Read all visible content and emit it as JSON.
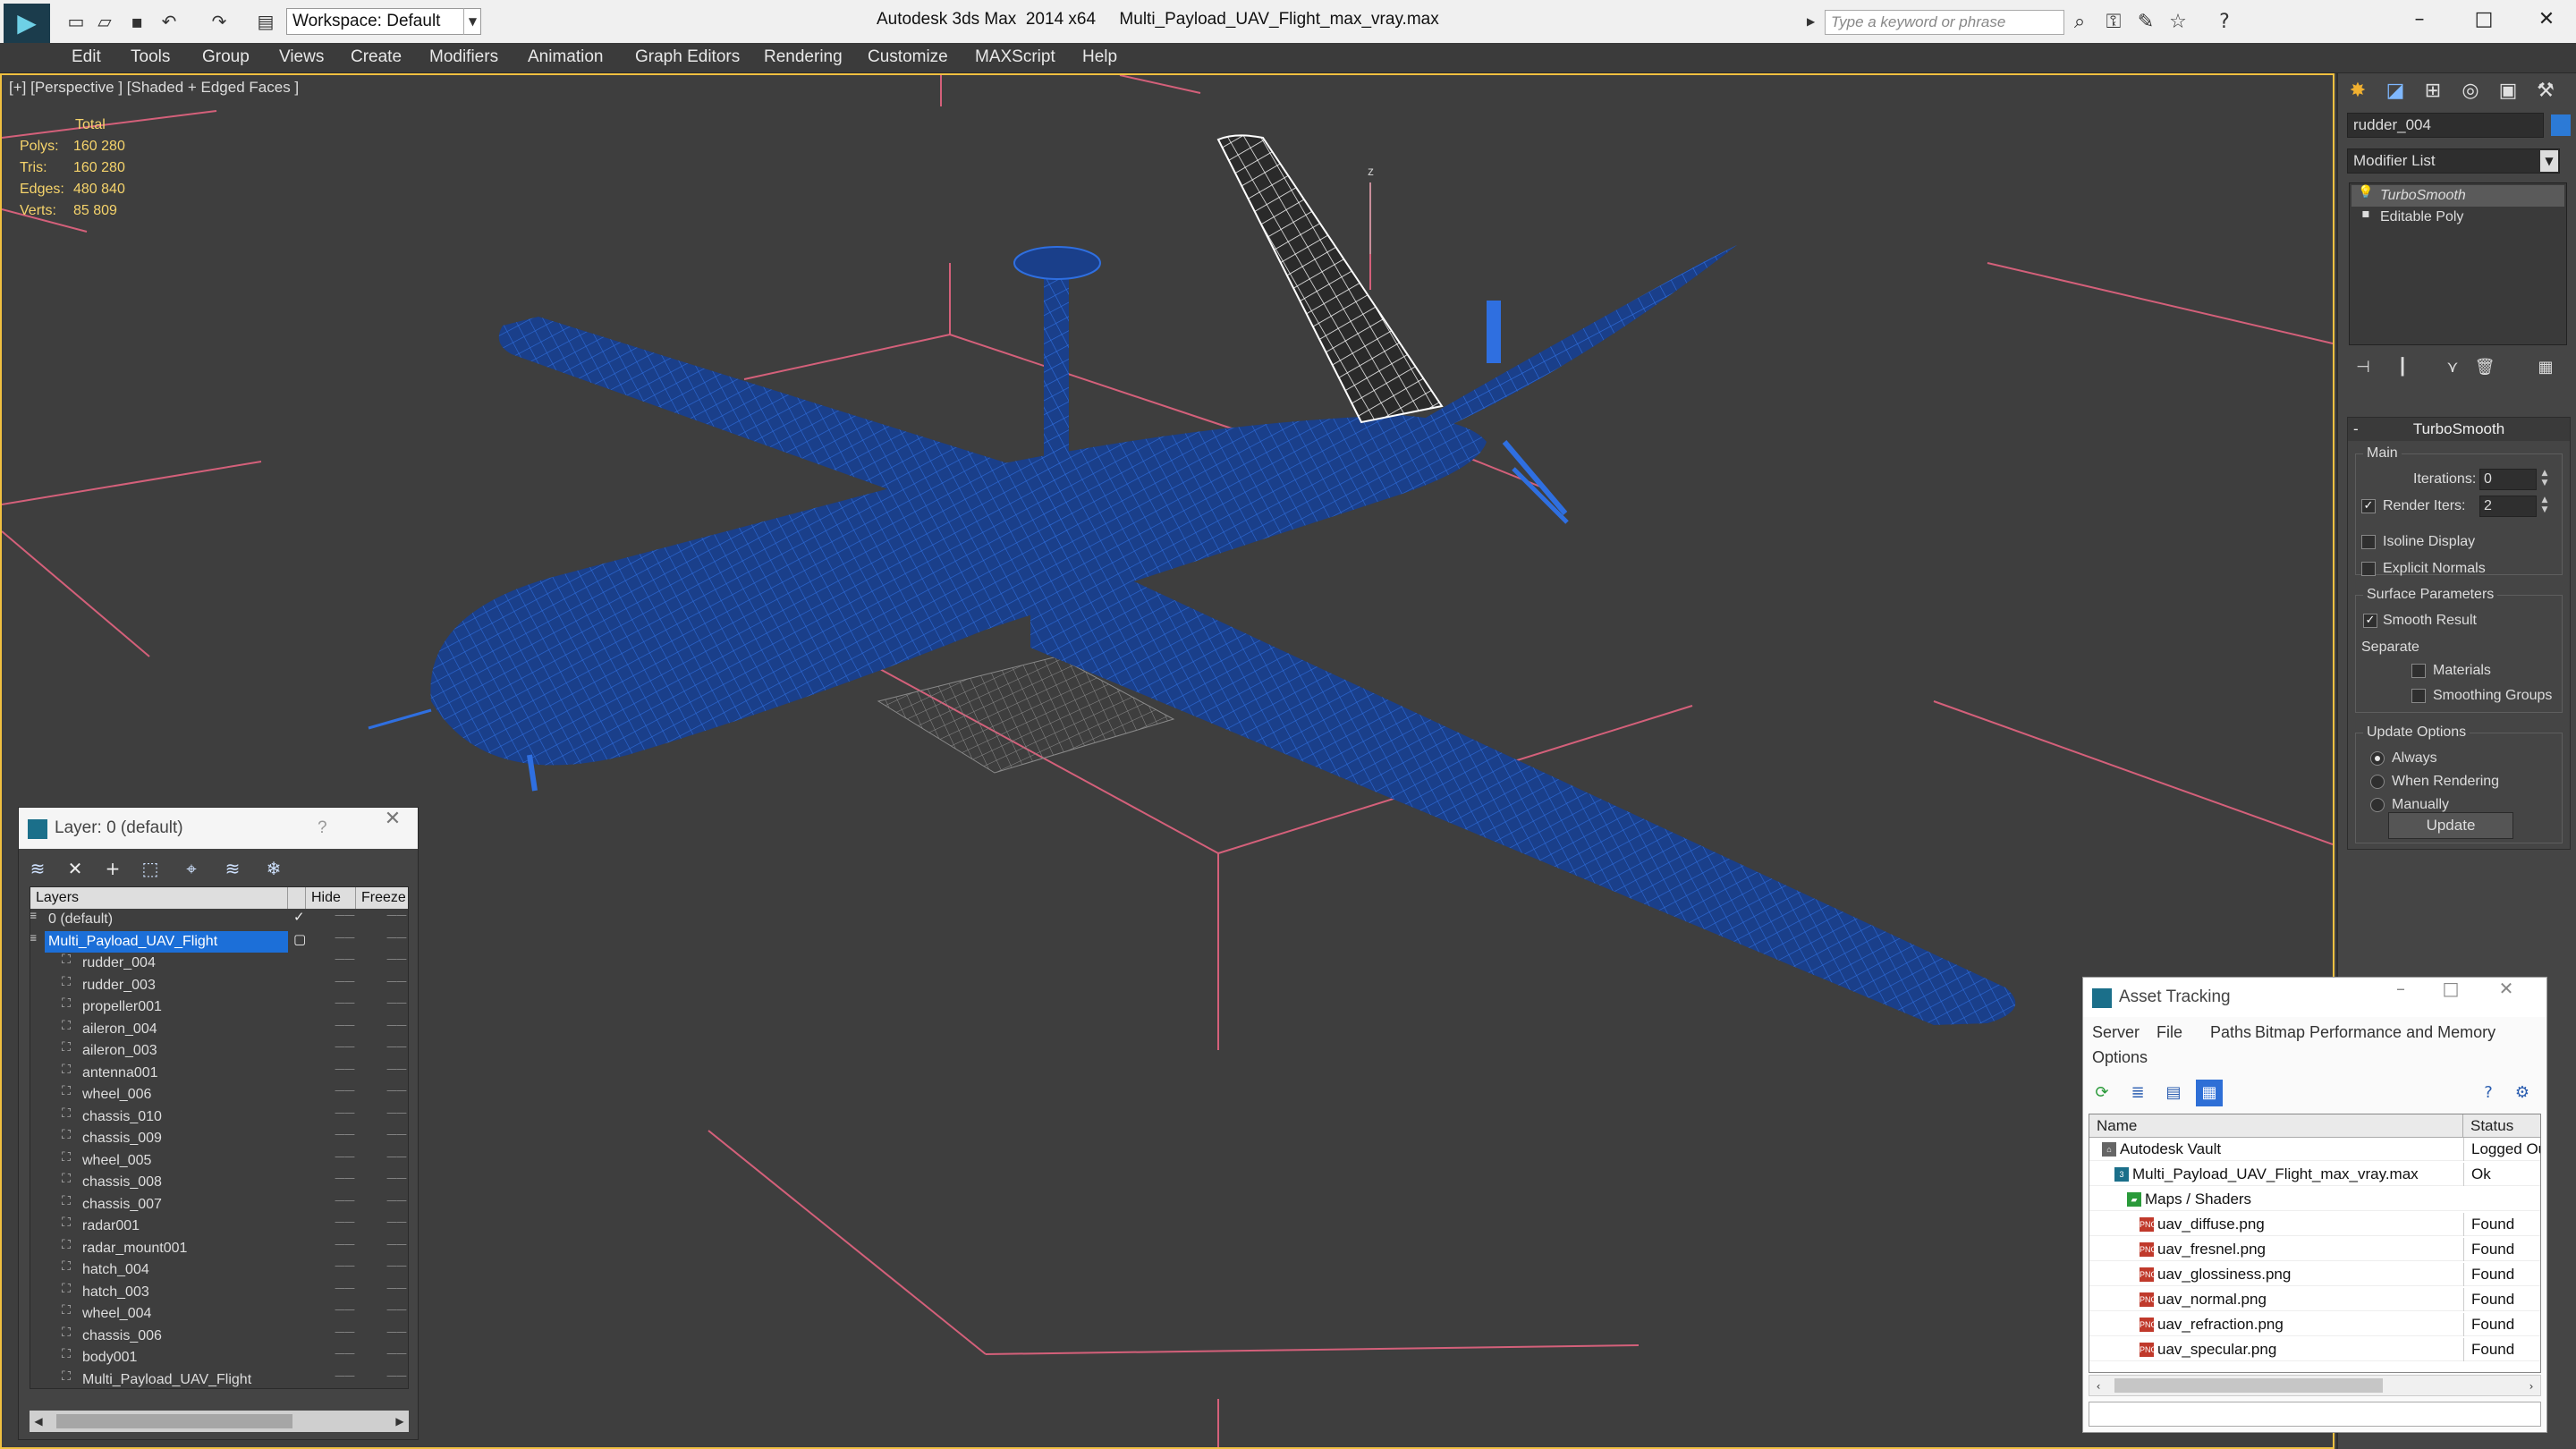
{
  "app": {
    "title": "Autodesk 3ds Max  2014 x64     Multi_Payload_UAV_Flight_max_vray.max",
    "logo": "3ds",
    "workspace": "Workspace: Default",
    "search_placeholder": "Type a keyword or phrase"
  },
  "menu": [
    "Edit",
    "Tools",
    "Group",
    "Views",
    "Create",
    "Modifiers",
    "Animation",
    "Graph Editors",
    "Rendering",
    "Customize",
    "MAXScript",
    "Help"
  ],
  "viewport": {
    "label": "[+] [Perspective ] [Shaded + Edged Faces ]",
    "stats": {
      "header": "Total",
      "rows": [
        {
          "key": "Polys:",
          "value": "160 280"
        },
        {
          "key": "Tris:",
          "value": "160 280"
        },
        {
          "key": "Edges:",
          "value": "480 840"
        },
        {
          "key": "Verts:",
          "value": "85 809"
        }
      ]
    },
    "axis_label": "z",
    "mesh_color": "#1a3f8a",
    "wire_color": "#2f6fe0",
    "grid_color": "#d4607a"
  },
  "command_panel": {
    "object_name": "rudder_004",
    "object_color": "#2c7ad6",
    "modifier_list": "Modifier List",
    "stack": [
      "TurboSmooth",
      "Editable Poly"
    ],
    "rollout_title": "TurboSmooth",
    "main": {
      "title": "Main",
      "iterations_label": "Iterations:",
      "iterations": "0",
      "render_iters_label": "Render Iters:",
      "render_iters": "2",
      "render_iters_checked": true,
      "isoline_label": "Isoline Display",
      "explicit_normals_label": "Explicit Normals"
    },
    "surface": {
      "title": "Surface Parameters",
      "smooth_result_label": "Smooth Result",
      "separate_label": "Separate",
      "materials_label": "Materials",
      "smoothing_groups_label": "Smoothing Groups"
    },
    "update": {
      "title": "Update Options",
      "always": "Always",
      "when_rendering": "When Rendering",
      "manually": "Manually",
      "button": "Update"
    }
  },
  "layer_panel": {
    "title": "Layer: 0 (default)",
    "help": "?",
    "columns": [
      "Layers",
      "Hide",
      "Freeze"
    ],
    "rows": [
      {
        "name": "0 (default)",
        "level": 0,
        "checked": true
      },
      {
        "name": "Multi_Payload_UAV_Flight",
        "level": 0,
        "selected": true
      },
      {
        "name": "rudder_004",
        "level": 1
      },
      {
        "name": "rudder_003",
        "level": 1
      },
      {
        "name": "propeller001",
        "level": 1
      },
      {
        "name": "aileron_004",
        "level": 1
      },
      {
        "name": "aileron_003",
        "level": 1
      },
      {
        "name": "antenna001",
        "level": 1
      },
      {
        "name": "wheel_006",
        "level": 1
      },
      {
        "name": "chassis_010",
        "level": 1
      },
      {
        "name": "chassis_009",
        "level": 1
      },
      {
        "name": "wheel_005",
        "level": 1
      },
      {
        "name": "chassis_008",
        "level": 1
      },
      {
        "name": "chassis_007",
        "level": 1
      },
      {
        "name": "radar001",
        "level": 1
      },
      {
        "name": "radar_mount001",
        "level": 1
      },
      {
        "name": "hatch_004",
        "level": 1
      },
      {
        "name": "hatch_003",
        "level": 1
      },
      {
        "name": "wheel_004",
        "level": 1
      },
      {
        "name": "chassis_006",
        "level": 1
      },
      {
        "name": "body001",
        "level": 1
      },
      {
        "name": "Multi_Payload_UAV_Flight",
        "level": 1
      }
    ]
  },
  "asset_panel": {
    "title": "Asset Tracking",
    "menu": [
      "Server",
      "File",
      "Paths",
      "Bitmap Performance and Memory",
      "Options"
    ],
    "columns": [
      "Name",
      "Status"
    ],
    "rows": [
      {
        "name": "Autodesk Vault",
        "status": "Logged Ou",
        "level": 0,
        "icon": "vault-icon"
      },
      {
        "name": "Multi_Payload_UAV_Flight_max_vray.max",
        "status": "Ok",
        "level": 1,
        "icon": "max-file-icon"
      },
      {
        "name": "Maps / Shaders",
        "status": "",
        "level": 2,
        "icon": "maps-icon"
      },
      {
        "name": "uav_diffuse.png",
        "status": "Found",
        "level": 3,
        "icon": "png-icon"
      },
      {
        "name": "uav_fresnel.png",
        "status": "Found",
        "level": 3,
        "icon": "png-icon"
      },
      {
        "name": "uav_glossiness.png",
        "status": "Found",
        "level": 3,
        "icon": "png-icon"
      },
      {
        "name": "uav_normal.png",
        "status": "Found",
        "level": 3,
        "icon": "png-icon"
      },
      {
        "name": "uav_refraction.png",
        "status": "Found",
        "level": 3,
        "icon": "png-icon"
      },
      {
        "name": "uav_specular.png",
        "status": "Found",
        "level": 3,
        "icon": "png-icon"
      }
    ]
  }
}
